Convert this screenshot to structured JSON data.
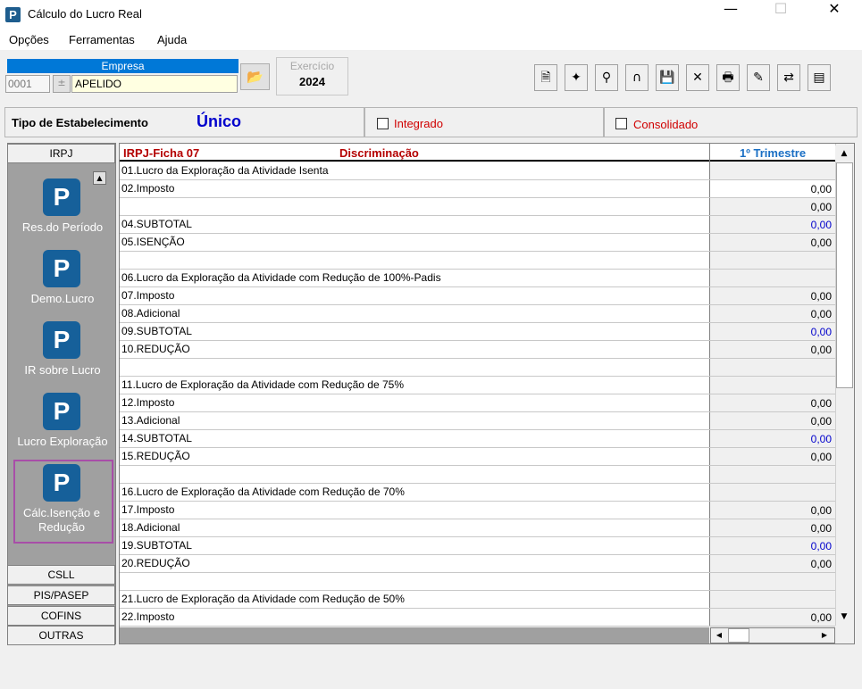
{
  "window": {
    "title": "Cálculo do Lucro Real",
    "logo_letter": "P",
    "minimize": "—",
    "maximize": "☐",
    "close": "✕"
  },
  "menu": [
    "Opções",
    "Ferramentas",
    "Ajuda"
  ],
  "empresa": {
    "label": "Empresa",
    "code": "0001",
    "name": "APELIDO",
    "spin": "±"
  },
  "exercicio": {
    "label": "Exercício",
    "value": "2024"
  },
  "toolbar": [
    {
      "name": "document-icon",
      "glyph": "🗎"
    },
    {
      "name": "nav-icon",
      "glyph": "✦"
    },
    {
      "name": "person-search-icon",
      "glyph": "⚲"
    },
    {
      "name": "lock-open-icon",
      "glyph": "∩"
    },
    {
      "name": "save-icon",
      "glyph": "💾"
    },
    {
      "name": "cancel-icon",
      "glyph": "✕"
    },
    {
      "name": "print-icon",
      "glyph": "🖶"
    },
    {
      "name": "edit-icon",
      "glyph": "✎"
    },
    {
      "name": "transfer-icon",
      "glyph": "⇄"
    },
    {
      "name": "calc-icon",
      "glyph": "▤"
    }
  ],
  "estabelecimento": {
    "label": "Tipo de Estabelecimento",
    "value": "Único",
    "integrado": "Integrado",
    "consolidado": "Consolidado"
  },
  "nav": {
    "top_tab": "IRPJ",
    "items": [
      {
        "label": "Res.do Período"
      },
      {
        "label": "Demo.Lucro"
      },
      {
        "label": "IR sobre Lucro"
      },
      {
        "label": "Lucro Exploração"
      },
      {
        "label": "Cálc.Isenção e Redução"
      }
    ],
    "bottom_tabs": [
      "CSLL",
      "PIS/PASEP",
      "COFINS",
      "OUTRAS"
    ]
  },
  "grid": {
    "header_ficha": "IRPJ-Ficha  07",
    "header_disc": "Discriminação",
    "header_col": "1º Trimestre",
    "rows": [
      {
        "desc": "01.Lucro da Exploração da Atividade Isenta",
        "value": "",
        "style": ""
      },
      {
        "desc": "02.Imposto",
        "value": "0,00",
        "style": "white"
      },
      {
        "desc": "",
        "value": "0,00",
        "style": ""
      },
      {
        "desc": "04.SUBTOTAL",
        "value": "0,00",
        "style": "blue"
      },
      {
        "desc": "05.ISENÇÃO",
        "value": "0,00",
        "style": ""
      },
      {
        "desc": "",
        "value": "",
        "style": ""
      },
      {
        "desc": "06.Lucro da Exploração da Atividade com Redução de 100%-Padis",
        "value": "",
        "style": ""
      },
      {
        "desc": "07.Imposto",
        "value": "0,00",
        "style": ""
      },
      {
        "desc": "08.Adicional",
        "value": "0,00",
        "style": ""
      },
      {
        "desc": "09.SUBTOTAL",
        "value": "0,00",
        "style": "blue"
      },
      {
        "desc": "10.REDUÇÃO",
        "value": "0,00",
        "style": ""
      },
      {
        "desc": "",
        "value": "",
        "style": ""
      },
      {
        "desc": "11.Lucro de Exploração da Atividade com Redução de 75%",
        "value": "",
        "style": ""
      },
      {
        "desc": "12.Imposto",
        "value": "0,00",
        "style": ""
      },
      {
        "desc": "13.Adicional",
        "value": "0,00",
        "style": ""
      },
      {
        "desc": "14.SUBTOTAL",
        "value": "0,00",
        "style": "blue"
      },
      {
        "desc": "15.REDUÇÃO",
        "value": "0,00",
        "style": ""
      },
      {
        "desc": "",
        "value": "",
        "style": ""
      },
      {
        "desc": "16.Lucro de Exploração da Atividade com Redução de 70%",
        "value": "",
        "style": ""
      },
      {
        "desc": "17.Imposto",
        "value": "0,00",
        "style": ""
      },
      {
        "desc": "18.Adicional",
        "value": "0,00",
        "style": ""
      },
      {
        "desc": "19.SUBTOTAL",
        "value": "0,00",
        "style": "blue"
      },
      {
        "desc": "20.REDUÇÃO",
        "value": "0,00",
        "style": ""
      },
      {
        "desc": "",
        "value": "",
        "style": ""
      },
      {
        "desc": "21.Lucro de Exploração da Atividade com Redução de 50%",
        "value": "",
        "style": ""
      },
      {
        "desc": "22.Imposto",
        "value": "0,00",
        "style": ""
      }
    ]
  },
  "scroll": {
    "up": "▲",
    "down": "▼",
    "left": "◀",
    "right": "▶"
  }
}
